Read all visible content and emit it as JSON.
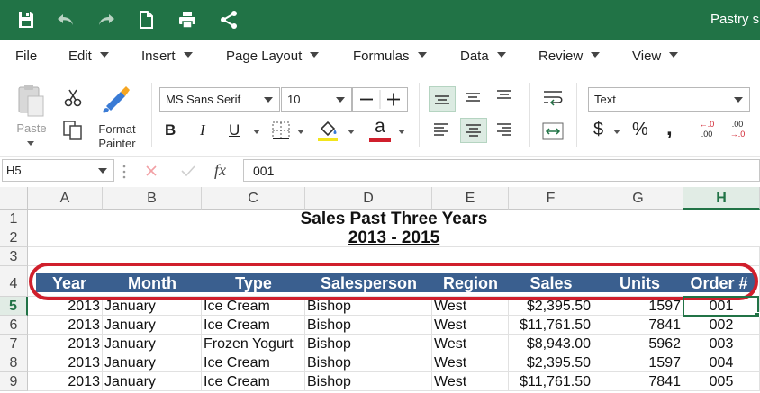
{
  "titlebar": {
    "doc_title": "Pastry s",
    "icons": [
      "save-icon",
      "undo-icon",
      "redo-icon",
      "new-document-icon",
      "print-icon",
      "share-icon"
    ]
  },
  "menu": {
    "items": [
      {
        "label": "File",
        "has_caret": false
      },
      {
        "label": "Edit",
        "has_caret": true
      },
      {
        "label": "Insert",
        "has_caret": true
      },
      {
        "label": "Page Layout",
        "has_caret": true
      },
      {
        "label": "Formulas",
        "has_caret": true
      },
      {
        "label": "Data",
        "has_caret": true
      },
      {
        "label": "Review",
        "has_caret": true
      },
      {
        "label": "View",
        "has_caret": true
      }
    ]
  },
  "ribbon": {
    "paste_label": "Paste",
    "format_painter_label_1": "Format",
    "format_painter_label_2": "Painter",
    "font_name": "MS Sans Serif",
    "font_size": "10",
    "bold_label": "B",
    "italic_label": "I",
    "underline_label": "U",
    "font_color_label": "a",
    "number_format": "Text",
    "currency_label": "$",
    "percent_label": "%",
    "comma_label": ",",
    "inc_decimal_label_1": "←.0",
    "inc_decimal_label_2": ".00",
    "dec_decimal_label_1": ".00",
    "dec_decimal_label_2": "→.0",
    "highlight_color": "#f2e51c",
    "font_color": "#d01f2c"
  },
  "formula_bar": {
    "name_box": "H5",
    "fx_label": "fx",
    "value": "001"
  },
  "sheet": {
    "columns": [
      "A",
      "B",
      "C",
      "D",
      "E",
      "F",
      "G",
      "H"
    ],
    "active_column": "H",
    "rows": [
      "1",
      "2",
      "3",
      "4",
      "5",
      "6",
      "7",
      "8",
      "9"
    ],
    "active_row": "5",
    "title": "Sales Past Three Years",
    "subtitle": "2013 - 2015",
    "headers": [
      "Year",
      "Month",
      "Type",
      "Salesperson",
      "Region",
      "Sales",
      "Units",
      "Order #"
    ],
    "data": [
      [
        "2013",
        "January",
        "Ice Cream",
        "Bishop",
        "West",
        "$2,395.50",
        "1597",
        "001"
      ],
      [
        "2013",
        "January",
        "Ice Cream",
        "Bishop",
        "West",
        "$11,761.50",
        "7841",
        "002"
      ],
      [
        "2013",
        "January",
        "Frozen Yogurt",
        "Bishop",
        "West",
        "$8,943.00",
        "5962",
        "003"
      ],
      [
        "2013",
        "January",
        "Ice Cream",
        "Bishop",
        "West",
        "$2,395.50",
        "1597",
        "004"
      ],
      [
        "2013",
        "January",
        "Ice Cream",
        "Bishop",
        "West",
        "$11,761.50",
        "7841",
        "005"
      ]
    ],
    "header_fill": "#3a5f8f",
    "annotation_color": "#d01f2c",
    "accent": "#217346"
  }
}
